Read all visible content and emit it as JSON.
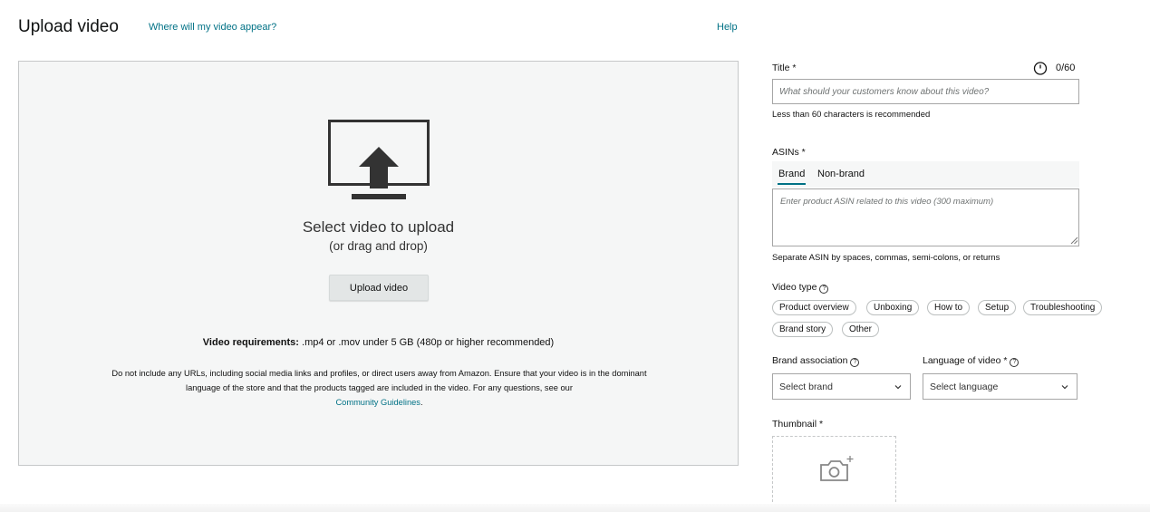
{
  "header": {
    "title": "Upload video",
    "appear_link": "Where will my video appear?",
    "help_link": "Help"
  },
  "dropzone": {
    "icon": "upload-monitor-icon",
    "main_text": "Select video to upload",
    "sub_text": "(or drag and drop)",
    "upload_button": "Upload video",
    "requirements_label": "Video requirements:",
    "requirements_text": ".mp4 or .mov under 5 GB (480p or higher recommended)",
    "disclaimer": "Do not include any URLs, including social media links and profiles, or direct users away from Amazon. Ensure that your video is in the dominant language of the store and that the products tagged are included in the video. For any questions, see our",
    "guidelines_link": "Community Guidelines",
    "guidelines_period": "."
  },
  "form": {
    "title": {
      "label": "Title *",
      "counter": "0/60",
      "placeholder": "What should your customers know about this video?",
      "hint": "Less than 60 characters is recommended"
    },
    "asins": {
      "label": "ASINs *",
      "tabs": [
        "Brand",
        "Non-brand"
      ],
      "active_tab": "Brand",
      "placeholder": "Enter product ASIN related to this video (300 maximum)",
      "hint": "Separate ASIN by spaces, commas, semi-colons, or returns"
    },
    "video_type": {
      "label": "Video type",
      "options": [
        "Product overview",
        "Unboxing",
        "How to",
        "Setup",
        "Troubleshooting",
        "Brand story",
        "Other"
      ]
    },
    "brand_association": {
      "label": "Brand association",
      "value": "Select brand"
    },
    "language": {
      "label": "Language of video *",
      "value": "Select language"
    },
    "thumbnail": {
      "label": "Thumbnail *",
      "icon": "add-photo-icon"
    }
  },
  "colors": {
    "link": "#007185",
    "dropzone_bg": "#f5f6f6",
    "border": "#a6a6a6"
  }
}
